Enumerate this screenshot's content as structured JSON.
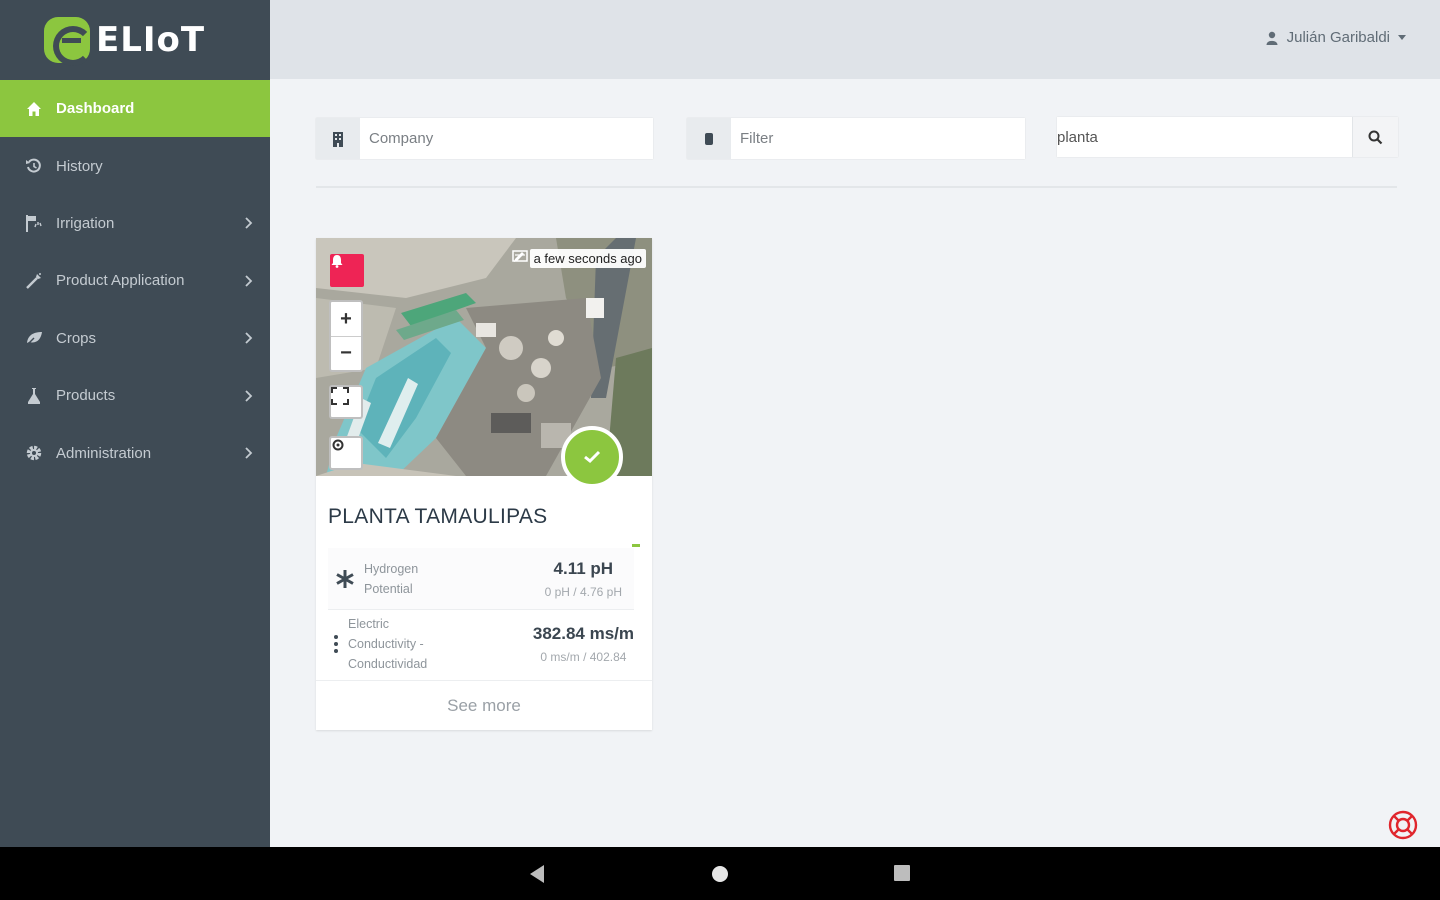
{
  "app": {
    "logo_text": "ELIoT",
    "brand_color": "#8cc63f",
    "sidebar_color": "#3f4b55"
  },
  "sidebar": {
    "items": [
      {
        "label": "Dashboard",
        "icon": "home-icon",
        "active": true,
        "has_children": false
      },
      {
        "label": "History",
        "icon": "history-icon",
        "active": false,
        "has_children": false
      },
      {
        "label": "Irrigation",
        "icon": "irrigation-icon",
        "active": false,
        "has_children": true
      },
      {
        "label": "Product Application",
        "icon": "sprayer-icon",
        "active": false,
        "has_children": true
      },
      {
        "label": "Crops",
        "icon": "leaf-icon",
        "active": false,
        "has_children": true
      },
      {
        "label": "Products",
        "icon": "flask-icon",
        "active": false,
        "has_children": true
      },
      {
        "label": "Administration",
        "icon": "gear-icon",
        "active": false,
        "has_children": true
      }
    ]
  },
  "topbar": {
    "user_name": "Julián Garibaldi"
  },
  "filters": {
    "company_placeholder": "Company",
    "filter_placeholder": "Filter",
    "search_value": "planta"
  },
  "card": {
    "title": "PLANTA TAMAULIPAS",
    "timestamp": "a few seconds ago",
    "status": "ok",
    "alert_color": "#ee2455",
    "map_controls": {
      "zoom_in": "+",
      "zoom_out": "−"
    },
    "metrics": [
      {
        "name_lines": [
          "Hydrogen",
          "Potential"
        ],
        "value": "4.11 pH",
        "range": "0 pH / 4.76 pH",
        "icon": "asterisk-icon"
      },
      {
        "name_lines": [
          "Electric",
          "Conductivity -",
          "Conductividad"
        ],
        "value": "382.84 ms/m",
        "range": "0 ms/m / 402.84",
        "icon": "vertical-dots-icon"
      }
    ],
    "see_more": "See more"
  }
}
